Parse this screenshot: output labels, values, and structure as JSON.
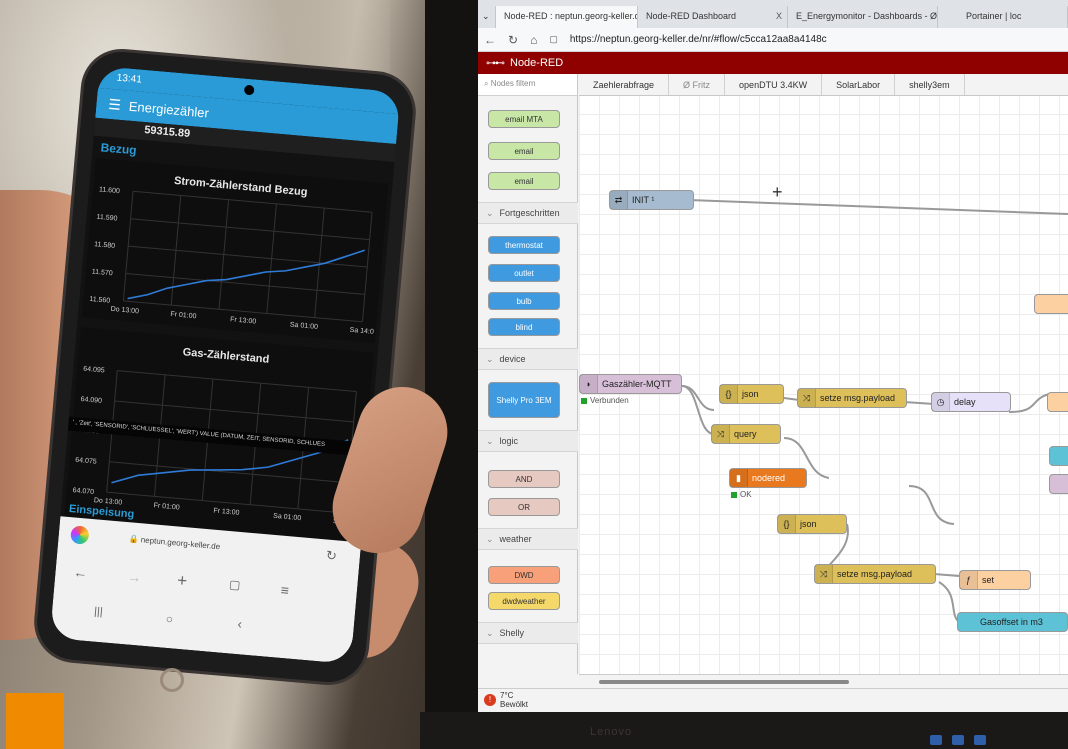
{
  "browser": {
    "tabs": [
      {
        "label": "Node-RED : neptun.georg-keller.d",
        "close": "X"
      },
      {
        "label": "Node-RED Dashboard",
        "close": "X"
      },
      {
        "label": "E_Energymonitor - Dashboards - Ø",
        "close": "X"
      },
      {
        "label": "Portainer | loc",
        "close": ""
      }
    ],
    "url": "https://neptun.georg-keller.de/nr/#flow/c5cca12aa8a4148c"
  },
  "nodered": {
    "title": "Node-RED",
    "filter_placeholder": "Nodes filtern",
    "flow_tabs": [
      "Zaehlerabfrage",
      "Ø Fritz",
      "openDTU 3.4KW",
      "SolarLabor",
      "shelly3em"
    ],
    "palette": {
      "email_nodes": [
        "email MTA",
        "email",
        "email"
      ],
      "categories": {
        "advanced": "Fortgeschritten",
        "device": "device",
        "logic": "logic",
        "weather": "weather",
        "shelly": "Shelly"
      },
      "advanced_nodes": [
        "thermostat",
        "outlet",
        "bulb",
        "blind"
      ],
      "device_nodes": [
        "Shelly Pro 3EM"
      ],
      "logic_nodes": [
        "AND",
        "OR"
      ],
      "weather_nodes": [
        "DWD",
        "dwdweather"
      ]
    },
    "flow_nodes": {
      "init": "INIT ¹",
      "mqtt": "Gaszähler-MQTT",
      "mqtt_status": "Verbunden",
      "json1": "json",
      "payload1": "setze msg.payload",
      "delay": "delay",
      "query": "query",
      "nodered": "nodered",
      "nodered_status": "OK",
      "json2": "json",
      "payload2": "setze msg.payload",
      "set": "set",
      "gasoffset": "Gasoffset in m3"
    },
    "weather_widget": {
      "temp": "7°C",
      "desc": "Bewölkt"
    }
  },
  "phone": {
    "time": "13:41",
    "app_title": "Energiezähler",
    "meter_value": "59315.89",
    "section_bezug": "Bezug",
    "section_einspeisung": "Einspeisung",
    "sql_text": "' , 'Zeit', 'SENSORID', 'SCHLUESSEL', 'WERT') VALUE (DATUM, ZEIT, SENSORID, SCHLUES",
    "url": "neptun.georg-keller.de"
  },
  "monitor": {
    "brand": "Lenovo"
  },
  "chart_data": [
    {
      "type": "line",
      "title": "Strom-Zählerstand Bezug",
      "xlabel": "",
      "ylabel": "",
      "x_ticks": [
        "Do 13:00",
        "Fr 01:00",
        "Fr 13:00",
        "Sa 01:00",
        "Sa 14:0"
      ],
      "y_ticks": [
        "11.600",
        "11.590",
        "11.580",
        "11.570",
        "11.560"
      ],
      "ylim": [
        11560,
        11600
      ],
      "series": [
        {
          "values": [
            11561,
            11563,
            11566,
            11568,
            11570,
            11571,
            11573,
            11575,
            11576,
            11578,
            11580,
            11583,
            11586
          ]
        }
      ],
      "color": "#2f7bd8"
    },
    {
      "type": "line",
      "title": "Gas-Zählerstand",
      "xlabel": "",
      "ylabel": "",
      "x_ticks": [
        "Do 13:00",
        "Fr 01:00",
        "Fr 13:00",
        "Sa 01:00",
        "Sa 14:0"
      ],
      "y_ticks": [
        "64.095",
        "64.090",
        "64.085",
        "64.075",
        "64.070"
      ],
      "ylim": [
        64070,
        64095
      ],
      "series": [
        {
          "values": [
            64072,
            64074,
            64075,
            64076,
            64076.5,
            64077,
            64078,
            64080,
            64082,
            64085
          ]
        }
      ],
      "color": "#2f7bd8"
    }
  ]
}
